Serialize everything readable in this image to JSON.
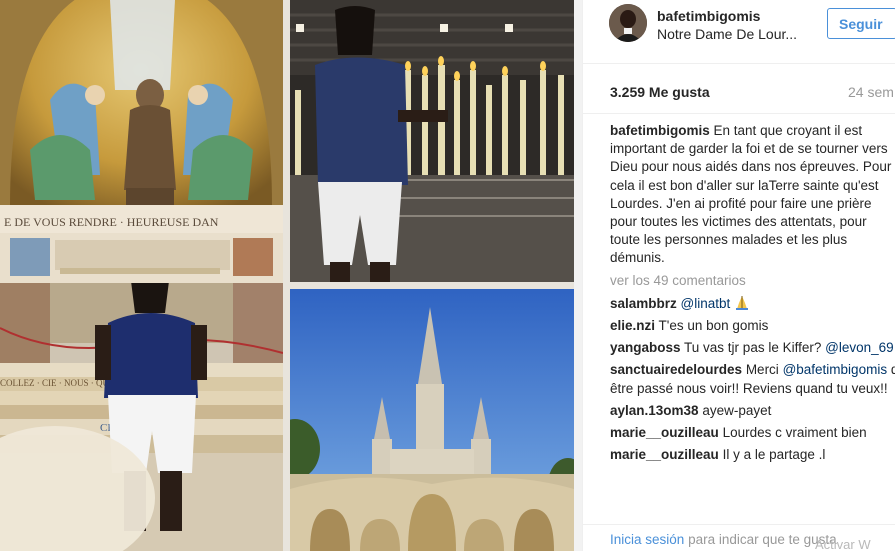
{
  "post": {
    "username": "bafetimbigomis",
    "location": "Notre Dame De Lour...",
    "follow_label": "Seguir",
    "likes": "3.259 Me gusta",
    "time_ago": "24 sem",
    "caption_user": "bafetimbigomis",
    "caption_text": "En tant que croyant il est important de garder la foi et de se tourner vers Dieu pour nous aidés dans nos épreuves. Pour cela il est bon d'aller sur laTerre sainte qu'est Lourdes. J'en ai profité pour faire une prière pour toutes les victimes des attentats, pour toute les personnes malades et les plus démunis.",
    "view_all": "ver los 49 comentarios"
  },
  "comments": [
    {
      "user": "salambbrz",
      "mention": "@linatbt",
      "text": "",
      "has_emoji": true,
      "emoji_icon": "praying-hands-icon"
    },
    {
      "user": "elie.nzi",
      "mention": "",
      "text": "T'es un bon gomis"
    },
    {
      "user": "yangaboss",
      "text": "Tu vas tjr pas le Kiffer?",
      "mention": "@levon_69"
    },
    {
      "user": "sanctuairedelourdes",
      "text": "Merci",
      "mention": "@bafetimbigomis",
      "text2": "d être passé nous voir!! Reviens quand tu veux!!"
    },
    {
      "user": "aylan.13om38",
      "mention": "",
      "text": "ayew-payet"
    },
    {
      "user": "marie__ouzilleau",
      "mention": "",
      "text": "Lourdes c vraiment bien"
    },
    {
      "user": "marie__ouzilleau",
      "mention": "",
      "text": "Il y a le partage .l"
    }
  ],
  "footer": {
    "login_link": "Inicia sesión",
    "login_suffix": "para indicar que te gusta",
    "watermark": "Activar W"
  },
  "colors": {
    "link_blue": "#4a90d9",
    "mention_blue": "#003569",
    "muted": "#999999",
    "border": "#efefef"
  },
  "photo": {
    "scene_icons": [
      "mosaic-icon",
      "candles-icon",
      "basilica-icon",
      "statue-icon"
    ]
  }
}
